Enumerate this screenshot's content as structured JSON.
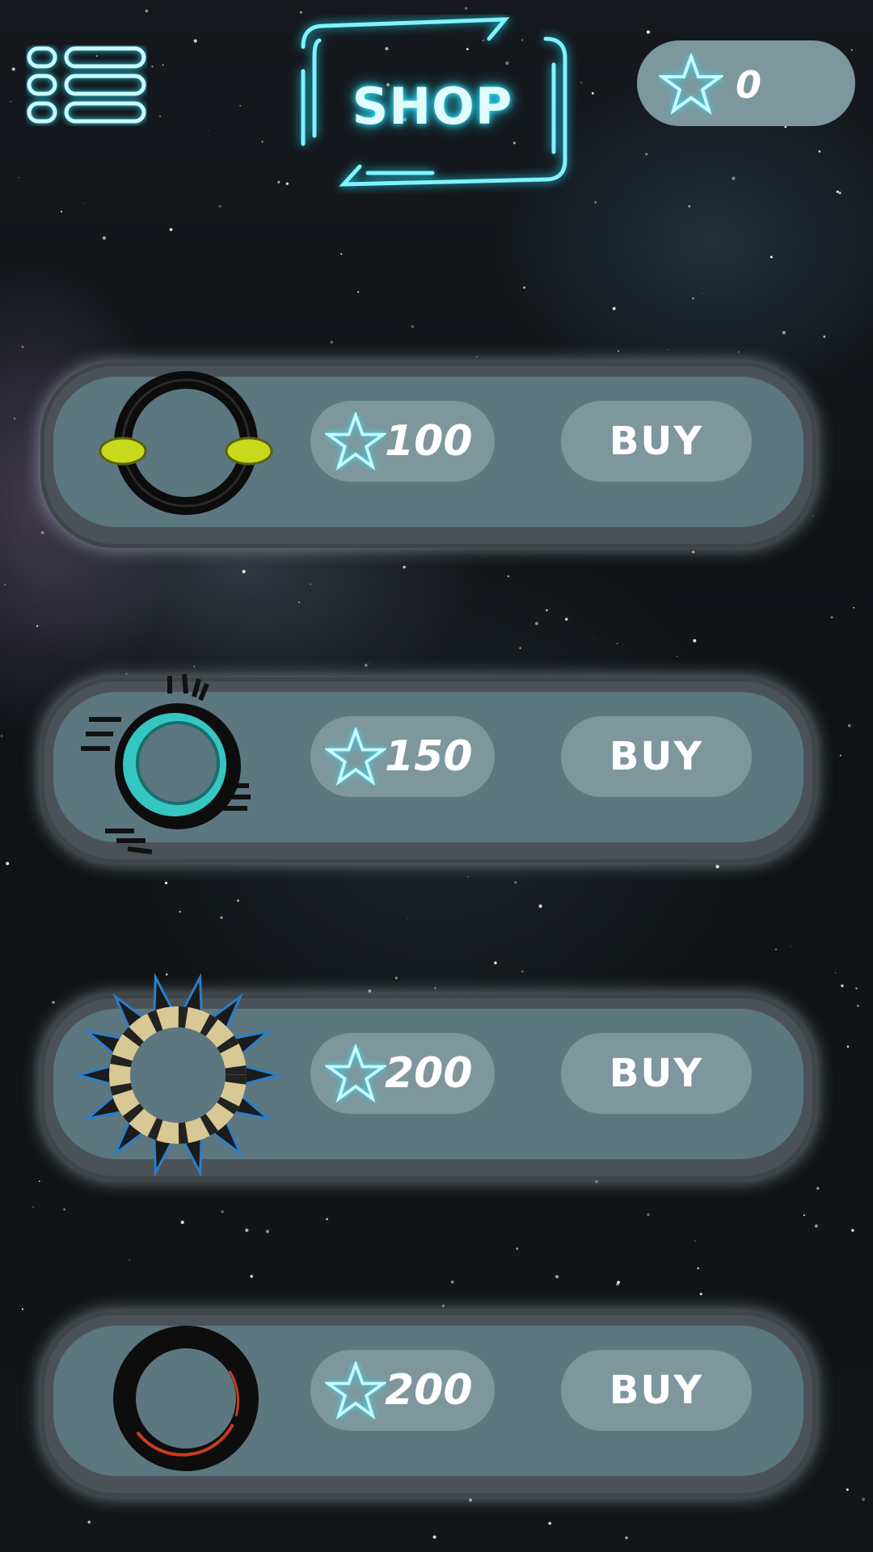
{
  "header": {
    "title": "SHOP",
    "menu_icon": "menu-list-icon",
    "star_balance": "0",
    "accent_color": "#35e3ff"
  },
  "shop_items": [
    {
      "price": "100",
      "buy_label": "BUY",
      "icon": "black-ring-yellow-gems-icon"
    },
    {
      "price": "150",
      "buy_label": "BUY",
      "icon": "cyan-ring-spikes-icon"
    },
    {
      "price": "200",
      "buy_label": "BUY",
      "icon": "blue-spiked-ring-icon"
    },
    {
      "price": "200",
      "buy_label": "BUY",
      "icon": "red-black-ring-icon"
    }
  ]
}
